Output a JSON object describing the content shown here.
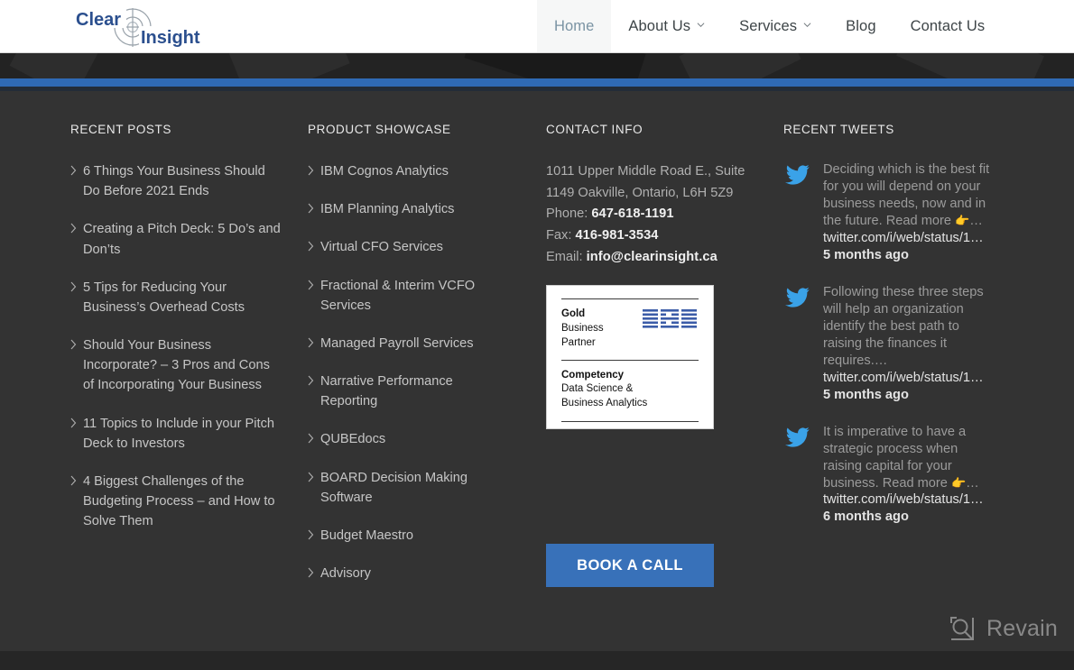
{
  "site": {
    "logo": {
      "word_one": "Clear",
      "word_two": "Insight",
      "mark": "crosshair-target-icon"
    }
  },
  "nav": {
    "items": [
      {
        "label": "Home",
        "active": true,
        "has_dropdown": false
      },
      {
        "label": "About Us",
        "active": false,
        "has_dropdown": true
      },
      {
        "label": "Services",
        "active": false,
        "has_dropdown": true
      },
      {
        "label": "Blog",
        "active": false,
        "has_dropdown": false
      },
      {
        "label": "Contact Us",
        "active": false,
        "has_dropdown": false
      }
    ]
  },
  "footer": {
    "recent_posts": {
      "title": "RECENT POSTS",
      "items": [
        "6 Things Your Business Should Do Before 2021 Ends",
        "Creating a Pitch Deck: 5 Do’s and Don’ts",
        "5 Tips for Reducing Your Business’s Overhead Costs",
        "Should Your Business Incorporate? – 3 Pros and Cons of Incorporating Your Business",
        "11 Topics to Include in your Pitch Deck to Investors",
        "4 Biggest Challenges of the Budgeting Process – and How to Solve Them"
      ]
    },
    "product_showcase": {
      "title": "PRODUCT SHOWCASE",
      "items": [
        "IBM Cognos Analytics",
        "IBM Planning Analytics",
        "Virtual CFO Services",
        "Fractional & Interim VCFO Services",
        "Managed Payroll Services",
        "Narrative Performance Reporting",
        "QUBEdocs",
        "BOARD Decision Making Software",
        "Budget Maestro",
        "Advisory"
      ]
    },
    "contact_info": {
      "title": "CONTACT INFO",
      "address_line_1": "1011 Upper Middle Road E., Suite",
      "address_line_2": "1149 Oakville, Ontario, L6H 5Z9",
      "phone_label": "Phone: ",
      "phone_value": "647-618-1191",
      "fax_label": "Fax: ",
      "fax_value": "416-981-3534",
      "email_label": "Email: ",
      "email_value": "info@clearinsight.ca",
      "badge": {
        "tier": "Gold",
        "partner_line_1": "Business",
        "partner_line_2": "Partner",
        "brand": "IBM",
        "competency_title": "Competency",
        "competency_line_1": "Data Science &",
        "competency_line_2": "Business Analytics"
      },
      "book_call_label": "BOOK A CALL"
    },
    "recent_tweets": {
      "title": "RECENT TWEETS",
      "items": [
        {
          "body": "Deciding which is the best fit for you will depend on your business needs, now and in the future. Read more ",
          "emoji": "👉",
          "ellipsis": "…",
          "link": "twitter.com/i/web/status/1…",
          "time": "5 months ago"
        },
        {
          "body": "Following these three steps will help an organization identify the best path to raising the finances it requires.…",
          "emoji": "",
          "ellipsis": "",
          "link": "twitter.com/i/web/status/1…",
          "time": "5 months ago"
        },
        {
          "body": "It is imperative to have a strategic process when raising capital for your business. Read more ",
          "emoji": "👉",
          "ellipsis": "…",
          "link": "twitter.com/i/web/status/1…",
          "time": "6 months ago"
        }
      ]
    }
  },
  "watermark": {
    "label": "Revain",
    "mark": "revain-logo-icon"
  },
  "colors": {
    "accent_blue": "#2f6ab5",
    "button_blue": "#3871b9",
    "footer_bg": "#333333",
    "hero_bg": "#232323",
    "twitter_blue": "#3aa2e8",
    "logo_blue": "#2b4f8e"
  }
}
